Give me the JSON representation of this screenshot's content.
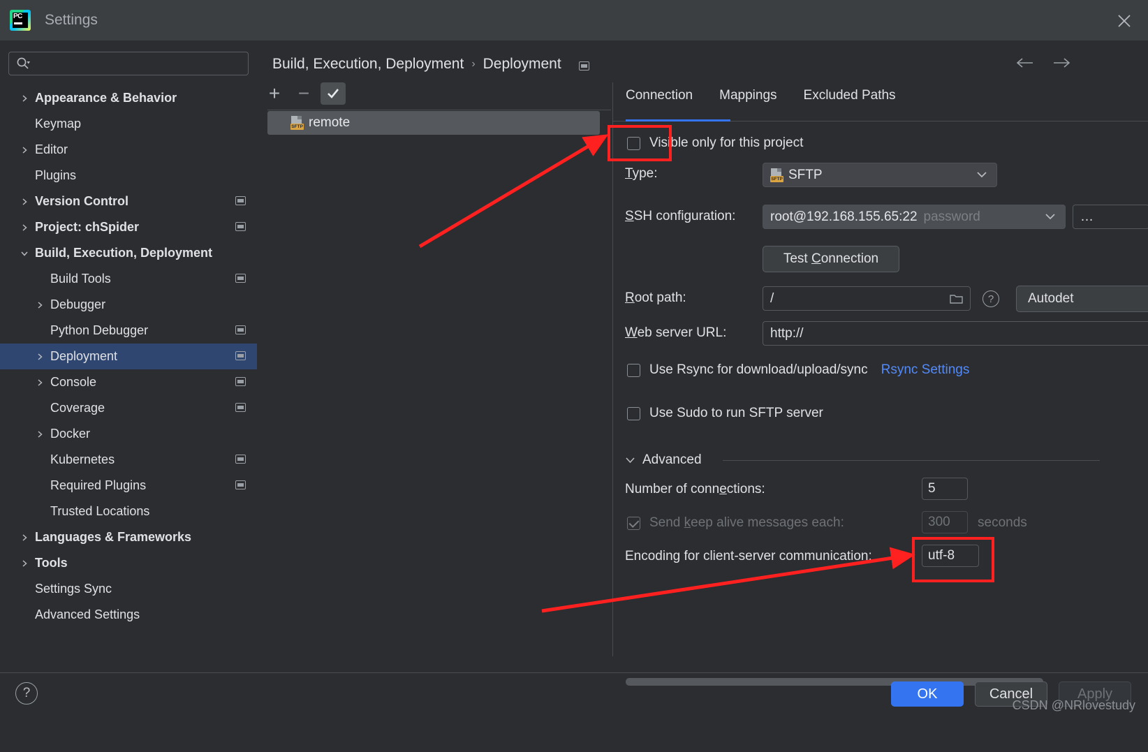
{
  "window": {
    "title": "Settings",
    "logo_text": "PC",
    "close_icon": "close-icon"
  },
  "search": {
    "value": "",
    "placeholder": ""
  },
  "sidebar": {
    "items": [
      {
        "label": "Appearance & Behavior",
        "indent": 0,
        "arrow": "right",
        "bold": true,
        "modified": false,
        "selected": false
      },
      {
        "label": "Keymap",
        "indent": 0,
        "arrow": "",
        "bold": false,
        "modified": false,
        "selected": false
      },
      {
        "label": "Editor",
        "indent": 0,
        "arrow": "right",
        "bold": false,
        "modified": false,
        "selected": false
      },
      {
        "label": "Plugins",
        "indent": 0,
        "arrow": "",
        "bold": false,
        "modified": false,
        "selected": false
      },
      {
        "label": "Version Control",
        "indent": 0,
        "arrow": "right",
        "bold": true,
        "modified": true,
        "selected": false
      },
      {
        "label": "Project: chSpider",
        "indent": 0,
        "arrow": "right",
        "bold": true,
        "modified": true,
        "selected": false
      },
      {
        "label": "Build, Execution, Deployment",
        "indent": 0,
        "arrow": "down",
        "bold": true,
        "modified": false,
        "selected": false
      },
      {
        "label": "Build Tools",
        "indent": 1,
        "arrow": "",
        "bold": false,
        "modified": true,
        "selected": false
      },
      {
        "label": "Debugger",
        "indent": 1,
        "arrow": "right",
        "bold": false,
        "modified": false,
        "selected": false
      },
      {
        "label": "Python Debugger",
        "indent": 1,
        "arrow": "",
        "bold": false,
        "modified": true,
        "selected": false
      },
      {
        "label": "Deployment",
        "indent": 1,
        "arrow": "right",
        "bold": false,
        "modified": true,
        "selected": true
      },
      {
        "label": "Console",
        "indent": 1,
        "arrow": "right",
        "bold": false,
        "modified": true,
        "selected": false
      },
      {
        "label": "Coverage",
        "indent": 1,
        "arrow": "",
        "bold": false,
        "modified": true,
        "selected": false
      },
      {
        "label": "Docker",
        "indent": 1,
        "arrow": "right",
        "bold": false,
        "modified": false,
        "selected": false
      },
      {
        "label": "Kubernetes",
        "indent": 1,
        "arrow": "",
        "bold": false,
        "modified": true,
        "selected": false
      },
      {
        "label": "Required Plugins",
        "indent": 1,
        "arrow": "",
        "bold": false,
        "modified": true,
        "selected": false
      },
      {
        "label": "Trusted Locations",
        "indent": 1,
        "arrow": "",
        "bold": false,
        "modified": false,
        "selected": false
      },
      {
        "label": "Languages & Frameworks",
        "indent": 0,
        "arrow": "right",
        "bold": true,
        "modified": false,
        "selected": false
      },
      {
        "label": "Tools",
        "indent": 0,
        "arrow": "right",
        "bold": true,
        "modified": false,
        "selected": false
      },
      {
        "label": "Settings Sync",
        "indent": 0,
        "arrow": "",
        "bold": false,
        "modified": false,
        "selected": false
      },
      {
        "label": "Advanced Settings",
        "indent": 0,
        "arrow": "",
        "bold": false,
        "modified": false,
        "selected": false
      }
    ]
  },
  "breadcrumb": {
    "root": "Build, Execution, Deployment",
    "separator": "›",
    "leaf": "Deployment"
  },
  "nav": {
    "back_icon": "arrow-left-icon",
    "forward_icon": "arrow-right-icon"
  },
  "config_list": {
    "toolbar": {
      "add_label": "+",
      "remove_label": "−",
      "set_default_icon": "check-icon"
    },
    "items": [
      {
        "name": "remote",
        "type_badge": "SFTP"
      }
    ]
  },
  "tabs": [
    {
      "label": "Connection",
      "active": true
    },
    {
      "label": "Mappings",
      "active": false
    },
    {
      "label": "Excluded Paths",
      "active": false
    }
  ],
  "connection": {
    "visible_only_label": "Visible only for this project",
    "visible_only_checked": false,
    "type_label": "Type:",
    "type_value": "SFTP",
    "type_badge": "SFTP",
    "ssh_label": "SSH configuration:",
    "ssh_value": "root@192.168.155.65:22",
    "ssh_auth_hint": "password",
    "test_connection_label": "Test Connection",
    "root_path_label": "Root path:",
    "root_path_value": "/",
    "autodetect_label": "Autodet",
    "web_url_label": "Web server URL:",
    "web_url_value": "http://",
    "rsync_label": "Use Rsync for download/upload/sync",
    "rsync_checked": false,
    "rsync_settings_link": "Rsync Settings",
    "sudo_label": "Use Sudo to run SFTP server",
    "sudo_checked": false
  },
  "advanced": {
    "section_label": "Advanced",
    "connections_label": "Number of connections:",
    "connections_value": "5",
    "keepalive_label": "Send keep alive messages each:",
    "keepalive_checked": true,
    "keepalive_value": "300",
    "keepalive_unit": "seconds",
    "encoding_label": "Encoding for client-server communication:",
    "encoding_value": "utf-8"
  },
  "footer": {
    "help_label": "?",
    "ok_label": "OK",
    "cancel_label": "Cancel",
    "apply_label": "Apply"
  },
  "watermark": "CSDN @NRlovestudy",
  "colors": {
    "background": "#2b2d30",
    "titlebar": "#3c3f41",
    "selection": "#2f4670",
    "accent": "#3574f0",
    "link": "#548af7",
    "annotation": "#ff2020",
    "sftp_badge": "#d9a441"
  }
}
